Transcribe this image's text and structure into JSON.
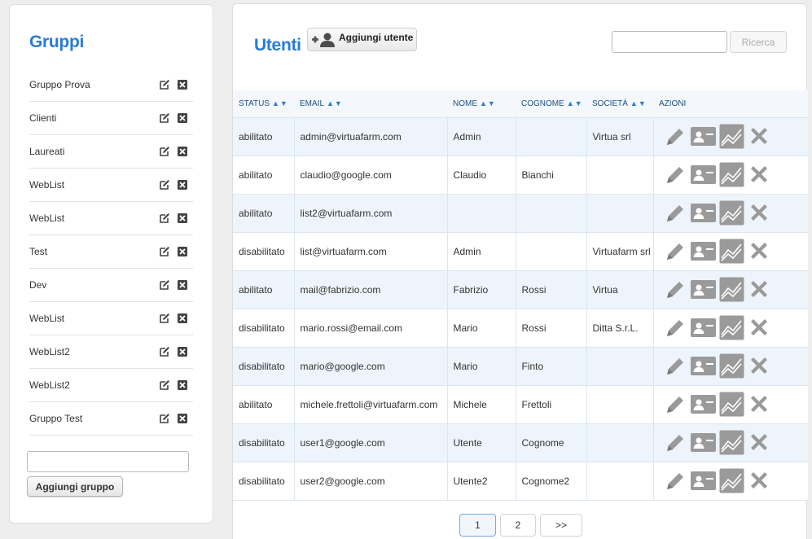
{
  "groups_panel": {
    "title": "Gruppi",
    "items": [
      {
        "label": "Gruppo Prova"
      },
      {
        "label": "Clienti"
      },
      {
        "label": "Laureati"
      },
      {
        "label": "WebList"
      },
      {
        "label": "WebList"
      },
      {
        "label": "Test"
      },
      {
        "label": "Dev"
      },
      {
        "label": "WebList"
      },
      {
        "label": "WebList2"
      },
      {
        "label": "WebList2"
      },
      {
        "label": "Gruppo Test"
      }
    ],
    "new_group_value": "",
    "add_group_label": "Aggiungi gruppo"
  },
  "users_panel": {
    "title": "Utenti",
    "add_user_label": "Aggiungi utente",
    "search_value": "",
    "search_button_label": "Ricerca",
    "columns": [
      "STATUS",
      "EMAIL",
      "NOME",
      "COGNOME",
      "SOCIETÀ",
      "AZIONI"
    ],
    "sort_arrows": "▲▼",
    "rows": [
      {
        "status": "abilitato",
        "email": "admin@virtuafarm.com",
        "nome": "Admin",
        "cognome": "",
        "societa": "Virtua srl"
      },
      {
        "status": "abilitato",
        "email": "claudio@google.com",
        "nome": "Claudio",
        "cognome": "Bianchi",
        "societa": ""
      },
      {
        "status": "abilitato",
        "email": "list2@virtuafarm.com",
        "nome": "",
        "cognome": "",
        "societa": ""
      },
      {
        "status": "disabilitato",
        "email": "list@virtuafarm.com",
        "nome": "Admin",
        "cognome": "",
        "societa": "Virtuafarm srl"
      },
      {
        "status": "abilitato",
        "email": "mail@fabrizio.com",
        "nome": "Fabrizio",
        "cognome": "Rossi",
        "societa": "Virtua"
      },
      {
        "status": "disabilitato",
        "email": "mario.rossi@email.com",
        "nome": "Mario",
        "cognome": "Rossi",
        "societa": "Ditta S.r.L."
      },
      {
        "status": "disabilitato",
        "email": "mario@google.com",
        "nome": "Mario",
        "cognome": "Finto",
        "societa": ""
      },
      {
        "status": "abilitato",
        "email": "michele.frettoli@virtuafarm.com",
        "nome": "Michele",
        "cognome": "Frettoli",
        "societa": ""
      },
      {
        "status": "disabilitato",
        "email": "user1@google.com",
        "nome": "Utente",
        "cognome": "Cognome",
        "societa": ""
      },
      {
        "status": "disabilitato",
        "email": "user2@google.com",
        "nome": "Utente2",
        "cognome": "Cognome2",
        "societa": ""
      }
    ],
    "row_actions": [
      "pencil-icon",
      "contact-card-icon",
      "chart-icon",
      "delete-x-icon"
    ],
    "pagination": {
      "pages": [
        "1",
        "2"
      ],
      "current": "1",
      "next_label": ">>"
    }
  },
  "colors": {
    "accent": "#2a7ad8",
    "header_text": "#1a4f8a",
    "row_alt": "#eef4fb",
    "action_icon": "#9a9a9a"
  }
}
